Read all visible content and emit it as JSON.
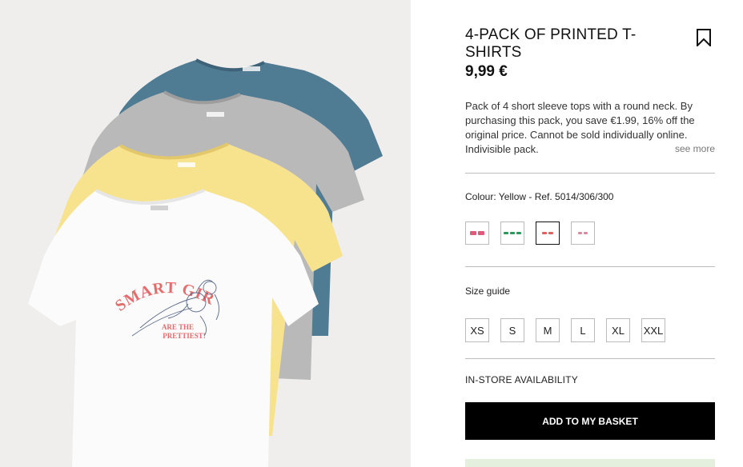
{
  "product": {
    "title": "4-PACK OF PRINTED T-SHIRTS",
    "price": "9,99 €",
    "description": "Pack of 4 short sleeve tops with a round neck. By purchasing this pack, you save €1.99, 16% off the original price. Cannot be sold individually online. Indivisible pack.",
    "see_more": "see more",
    "colour_label": "Colour: Yellow - Ref. 5014/306/300",
    "swatches": [
      {
        "name": "pink-print",
        "accent": "#e05a7a",
        "selected": false
      },
      {
        "name": "green-print",
        "accent": "#2a9a5a",
        "selected": false
      },
      {
        "name": "red-print",
        "accent": "#e06060",
        "selected": true
      },
      {
        "name": "light-print",
        "accent": "#d88aa0",
        "selected": false
      }
    ],
    "size_guide": "Size guide",
    "sizes": [
      "XS",
      "S",
      "M",
      "L",
      "XL",
      "XXL"
    ],
    "availability": "IN-STORE AVAILABILITY",
    "add_to_basket": "ADD TO MY BASKET"
  },
  "image": {
    "print_line1": "SMART GIRLS",
    "print_line2": "ARE THE",
    "print_line3": "PRETTIEST!",
    "shirt_colors": {
      "teal": "#4d7a92",
      "grey": "#b8b8b8",
      "yellow": "#f6e08c",
      "white": "#fbfbfb"
    },
    "print_color": "#e46c6c"
  },
  "icons": {
    "bookmark": "bookmark-icon"
  }
}
